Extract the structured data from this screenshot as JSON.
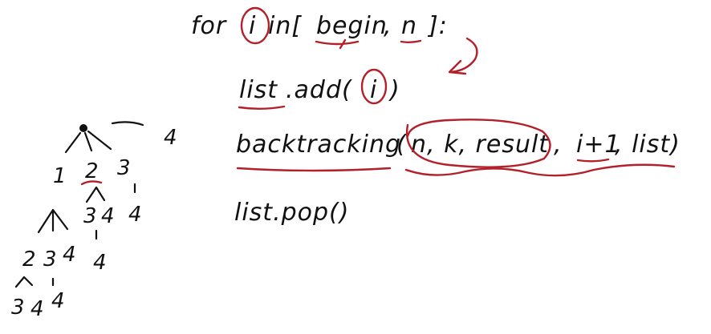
{
  "code": {
    "line1": {
      "kw": "for",
      "var": "i",
      "rest": "in[",
      "begin": "begin",
      "sep": ",",
      "n": "n",
      "close": "]:"
    },
    "line2": {
      "list": "list",
      "call": ".add(",
      "arg": "i",
      "end": ")"
    },
    "line3": {
      "fn": "backtracking",
      "open": "(",
      "args": "n, k, result",
      "sep": ",",
      "inc": "i+1",
      "tail": ", list)"
    },
    "line4": "list.pop()"
  },
  "tree": {
    "top_right": "4",
    "level1": [
      "1",
      "2",
      "3"
    ],
    "level1_right": "4",
    "level2_right": [
      "3",
      "4",
      "4"
    ],
    "level2_left": [
      "2",
      "3",
      "4"
    ],
    "level2_left_right": "4",
    "level3": [
      "3",
      "4",
      "4"
    ]
  },
  "colors": {
    "ink": "#111111",
    "annotation": "#b3202a"
  }
}
